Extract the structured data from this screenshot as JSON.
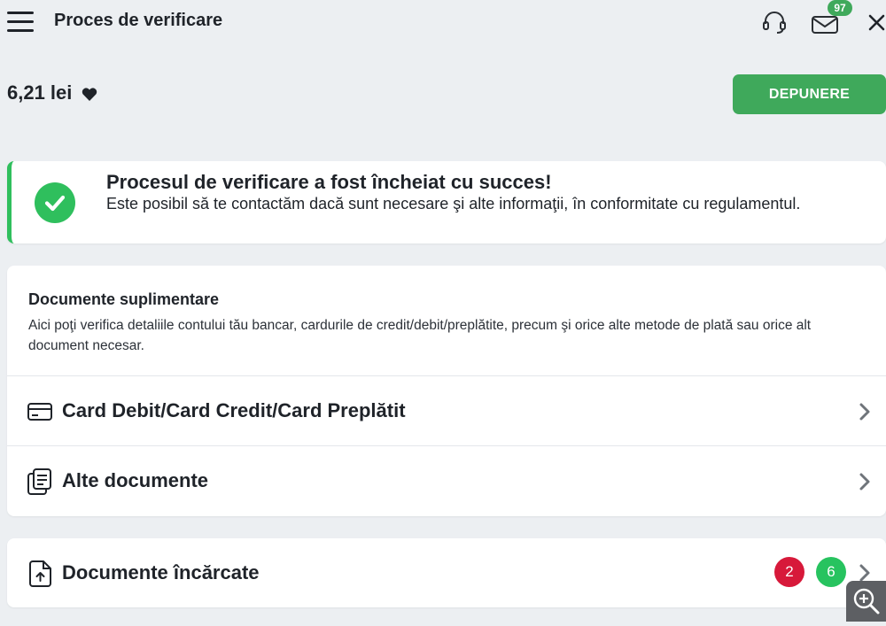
{
  "header": {
    "title": "Proces de verificare",
    "mail_badge": "97"
  },
  "balance": {
    "amount": "6,21 lei"
  },
  "deposit_button": "DEPUNERE",
  "success": {
    "title": "Procesul de verificare a fost încheiat cu succes!",
    "text": "Este posibil să te contactăm dacă sunt necesare şi alte informaţii, în conformitate cu regulamentul."
  },
  "docs": {
    "title": "Documente suplimentare",
    "description": "Aici poţi verifica detaliile contului tău bancar, cardurile de credit/debit/preplătite, precum şi orice alte metode de plată sau orice alt document necesar.",
    "items": [
      {
        "label": "Card Debit/Card Credit/Card Preplătit",
        "icon": "credit-card-icon"
      },
      {
        "label": "Alte documente",
        "icon": "documents-icon"
      }
    ]
  },
  "uploaded": {
    "label": "Documente încărcate",
    "rejected_count": "2",
    "approved_count": "6"
  },
  "colors": {
    "accent_green": "#3fa95b",
    "success_green": "#2fbf5d",
    "badge_red": "#d7193a",
    "badge_green": "#27c35f",
    "background": "#eceff2"
  }
}
